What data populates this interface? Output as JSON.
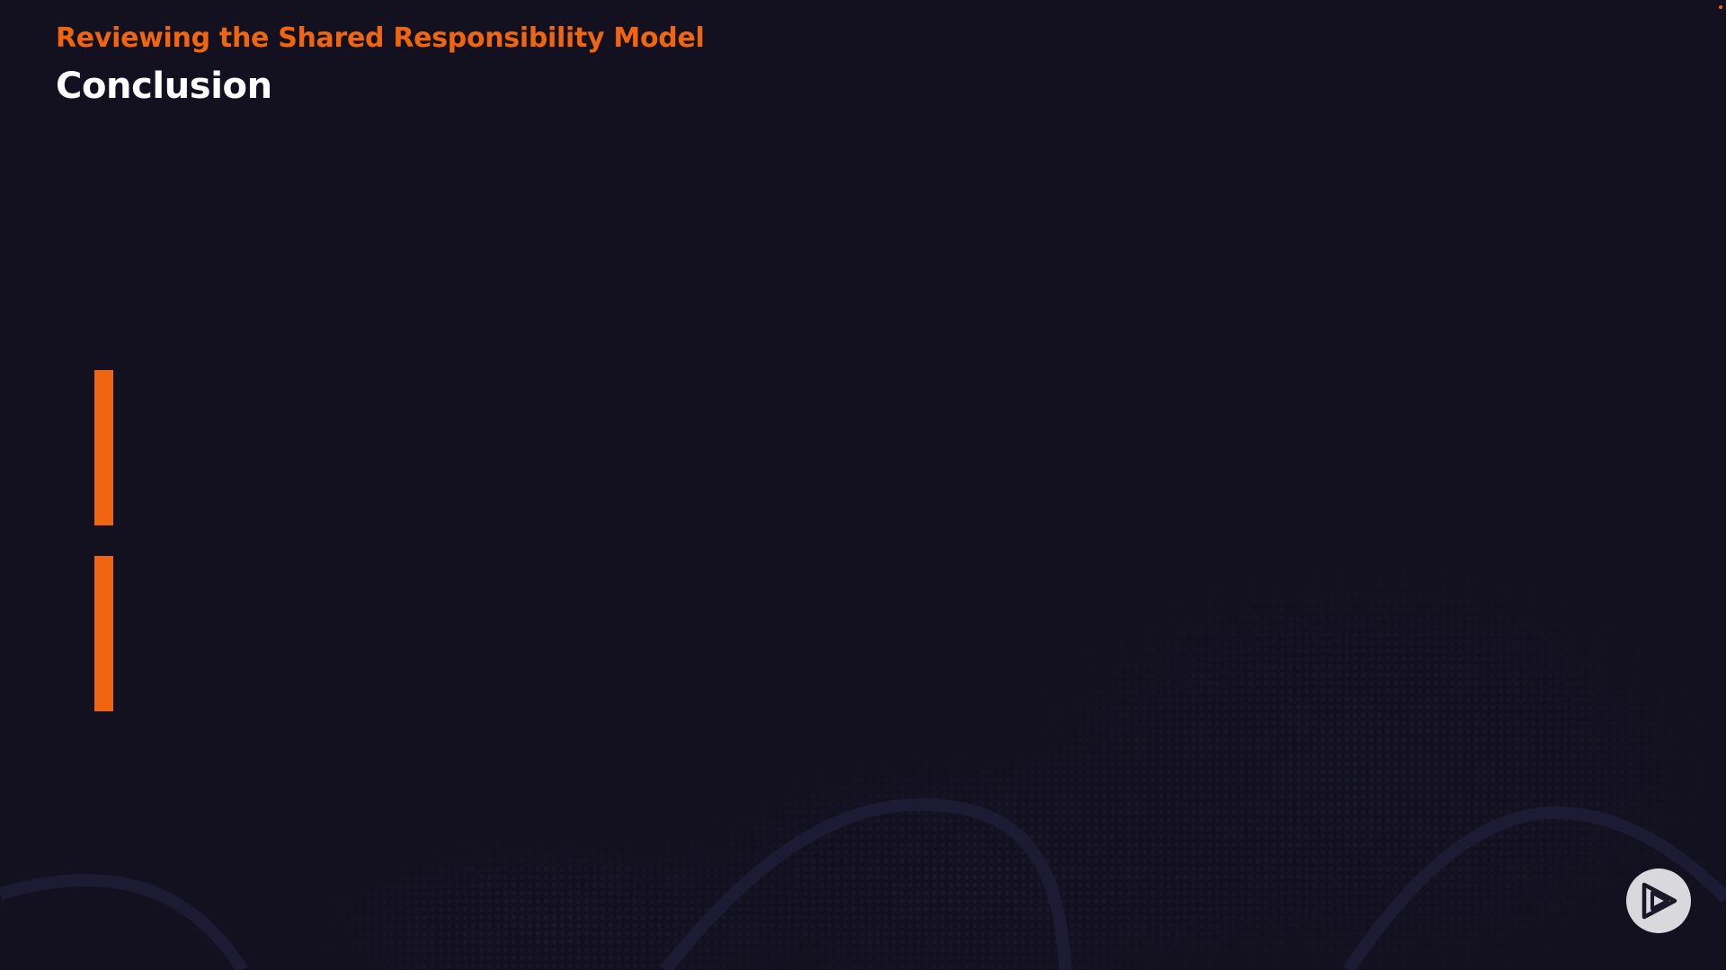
{
  "slide": {
    "subtitle": "Reviewing the Shared Responsibility Model",
    "title": "Conclusion"
  },
  "colors": {
    "background": "#13111f",
    "accent": "#f0650f",
    "title": "#ffffff",
    "wave": "#1d1b33",
    "logo_bg": "#d9d8dc",
    "logo_fg": "#1a1828"
  },
  "icons": {
    "logo": "play-logo-icon"
  }
}
